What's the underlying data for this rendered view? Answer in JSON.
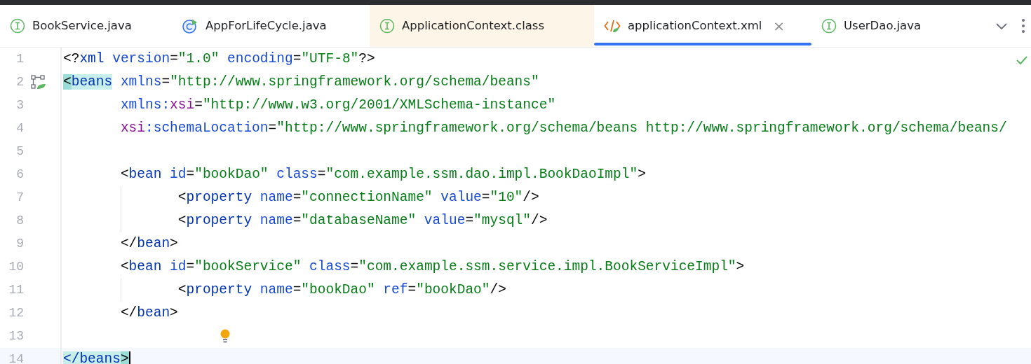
{
  "tabs": [
    {
      "label": "BookService.java",
      "kind": "interface",
      "selected": false,
      "tinted": false
    },
    {
      "label": "AppForLifeCycle.java",
      "kind": "runnable-class",
      "selected": false,
      "tinted": false
    },
    {
      "label": "ApplicationContext.class",
      "kind": "interface",
      "selected": false,
      "tinted": true
    },
    {
      "label": "applicationContext.xml",
      "kind": "xml",
      "selected": true,
      "tinted": false,
      "close_glyph": "×"
    },
    {
      "label": "UserDao.java",
      "kind": "interface",
      "selected": false,
      "tinted": false
    }
  ],
  "editor": {
    "no_problems": true,
    "lines": [
      {
        "number": "1",
        "current": false,
        "gutter_icon": false,
        "bulb": false,
        "tokens": [
          {
            "kind": "punct",
            "text": "<?"
          },
          {
            "kind": "tag",
            "text": "xml"
          },
          {
            "kind": "attr",
            "text": " version"
          },
          {
            "kind": "punct",
            "text": "="
          },
          {
            "kind": "value",
            "text": "\"1.0\""
          },
          {
            "kind": "attr",
            "text": " encoding"
          },
          {
            "kind": "punct",
            "text": "="
          },
          {
            "kind": "value",
            "text": "\"UTF-8\""
          },
          {
            "kind": "punct",
            "text": "?>"
          }
        ]
      },
      {
        "number": "2",
        "current": false,
        "gutter_icon": true,
        "bulb": false,
        "tokens": [
          {
            "kind": "match",
            "text": "<"
          },
          {
            "kind": "tag-match",
            "text": "beans"
          },
          {
            "kind": "attr",
            "text": " xmlns"
          },
          {
            "kind": "punct",
            "text": "="
          },
          {
            "kind": "value",
            "text": "\"http://www.springframework.org/schema/beans\""
          }
        ],
        "children": [
          {
            "number": "3",
            "current": false,
            "gutter_icon": false,
            "bulb": false,
            "tokens": [
              {
                "kind": "attr",
                "text": "xmlns:"
              },
              {
                "kind": "ns",
                "text": "xsi"
              },
              {
                "kind": "punct",
                "text": "="
              },
              {
                "kind": "value",
                "text": "\"http://www.w3.org/2001/XMLSchema-instance\""
              }
            ]
          },
          {
            "number": "4",
            "current": false,
            "gutter_icon": false,
            "bulb": false,
            "tokens": [
              {
                "kind": "ns",
                "text": "xsi"
              },
              {
                "kind": "attr",
                "text": ":schemaLocation"
              },
              {
                "kind": "punct",
                "text": "="
              },
              {
                "kind": "value",
                "text": "\"http://www.springframework.org/schema/beans http://www.springframework.org/schema/beans/"
              }
            ]
          },
          {
            "number": "5",
            "current": false,
            "gutter_icon": false,
            "bulb": false
          },
          {
            "number": "6",
            "current": false,
            "gutter_icon": false,
            "bulb": false,
            "tokens": [
              {
                "kind": "punct",
                "text": "<"
              },
              {
                "kind": "tag",
                "text": "bean"
              },
              {
                "kind": "attr",
                "text": " id"
              },
              {
                "kind": "punct",
                "text": "="
              },
              {
                "kind": "value",
                "text": "\"bookDao\""
              },
              {
                "kind": "attr",
                "text": " class"
              },
              {
                "kind": "punct",
                "text": "="
              },
              {
                "kind": "value",
                "text": "\"com.example.ssm.dao.impl.BookDaoImpl\""
              },
              {
                "kind": "punct",
                "text": ">"
              }
            ],
            "children": [
              {
                "number": "7",
                "current": false,
                "gutter_icon": false,
                "bulb": false,
                "tokens": [
                  {
                    "kind": "punct",
                    "text": "<"
                  },
                  {
                    "kind": "tag",
                    "text": "property"
                  },
                  {
                    "kind": "attr",
                    "text": " name"
                  },
                  {
                    "kind": "punct",
                    "text": "="
                  },
                  {
                    "kind": "value",
                    "text": "\"connectionName\""
                  },
                  {
                    "kind": "attr",
                    "text": " value"
                  },
                  {
                    "kind": "punct",
                    "text": "="
                  },
                  {
                    "kind": "value",
                    "text": "\"10\""
                  },
                  {
                    "kind": "punct",
                    "text": "/>"
                  }
                ]
              },
              {
                "number": "8",
                "current": false,
                "gutter_icon": false,
                "bulb": false,
                "tokens": [
                  {
                    "kind": "punct",
                    "text": "<"
                  },
                  {
                    "kind": "tag",
                    "text": "property"
                  },
                  {
                    "kind": "attr",
                    "text": " name"
                  },
                  {
                    "kind": "punct",
                    "text": "="
                  },
                  {
                    "kind": "value",
                    "text": "\"databaseName\""
                  },
                  {
                    "kind": "attr",
                    "text": " value"
                  },
                  {
                    "kind": "punct",
                    "text": "="
                  },
                  {
                    "kind": "value",
                    "text": "\"mysql\""
                  },
                  {
                    "kind": "punct",
                    "text": "/>"
                  }
                ]
              }
            ]
          },
          {
            "number": "9",
            "current": false,
            "gutter_icon": false,
            "bulb": false,
            "tokens": [
              {
                "kind": "punct",
                "text": "</"
              },
              {
                "kind": "tag",
                "text": "bean"
              },
              {
                "kind": "punct",
                "text": ">"
              }
            ]
          },
          {
            "number": "10",
            "current": false,
            "gutter_icon": false,
            "bulb": false,
            "tokens": [
              {
                "kind": "punct",
                "text": "<"
              },
              {
                "kind": "tag",
                "text": "bean"
              },
              {
                "kind": "attr",
                "text": " id"
              },
              {
                "kind": "punct",
                "text": "="
              },
              {
                "kind": "value",
                "text": "\"bookService\""
              },
              {
                "kind": "attr",
                "text": " class"
              },
              {
                "kind": "punct",
                "text": "="
              },
              {
                "kind": "value",
                "text": "\"com.example.ssm.service.impl.BookServiceImpl\""
              },
              {
                "kind": "punct",
                "text": ">"
              }
            ],
            "children": [
              {
                "number": "11",
                "current": false,
                "gutter_icon": false,
                "bulb": false,
                "tokens": [
                  {
                    "kind": "punct",
                    "text": "<"
                  },
                  {
                    "kind": "tag",
                    "text": "property"
                  },
                  {
                    "kind": "attr",
                    "text": " name"
                  },
                  {
                    "kind": "punct",
                    "text": "="
                  },
                  {
                    "kind": "value",
                    "text": "\"bookDao\""
                  },
                  {
                    "kind": "attr",
                    "text": " ref"
                  },
                  {
                    "kind": "punct",
                    "text": "="
                  },
                  {
                    "kind": "value",
                    "text": "\"bookDao\""
                  },
                  {
                    "kind": "punct",
                    "text": "/>"
                  }
                ]
              }
            ]
          },
          {
            "number": "12",
            "current": false,
            "gutter_icon": false,
            "bulb": false,
            "tokens": [
              {
                "kind": "punct",
                "text": "</"
              },
              {
                "kind": "tag",
                "text": "bean"
              },
              {
                "kind": "punct",
                "text": ">"
              }
            ]
          },
          {
            "number": "13",
            "current": false,
            "gutter_icon": false,
            "bulb": true
          }
        ]
      },
      {
        "number": "14",
        "current": true,
        "gutter_icon": false,
        "bulb": false,
        "tokens": [
          {
            "kind": "tag-match",
            "text": "</beans"
          },
          {
            "kind": "match",
            "text": ">"
          }
        ]
      }
    ]
  }
}
